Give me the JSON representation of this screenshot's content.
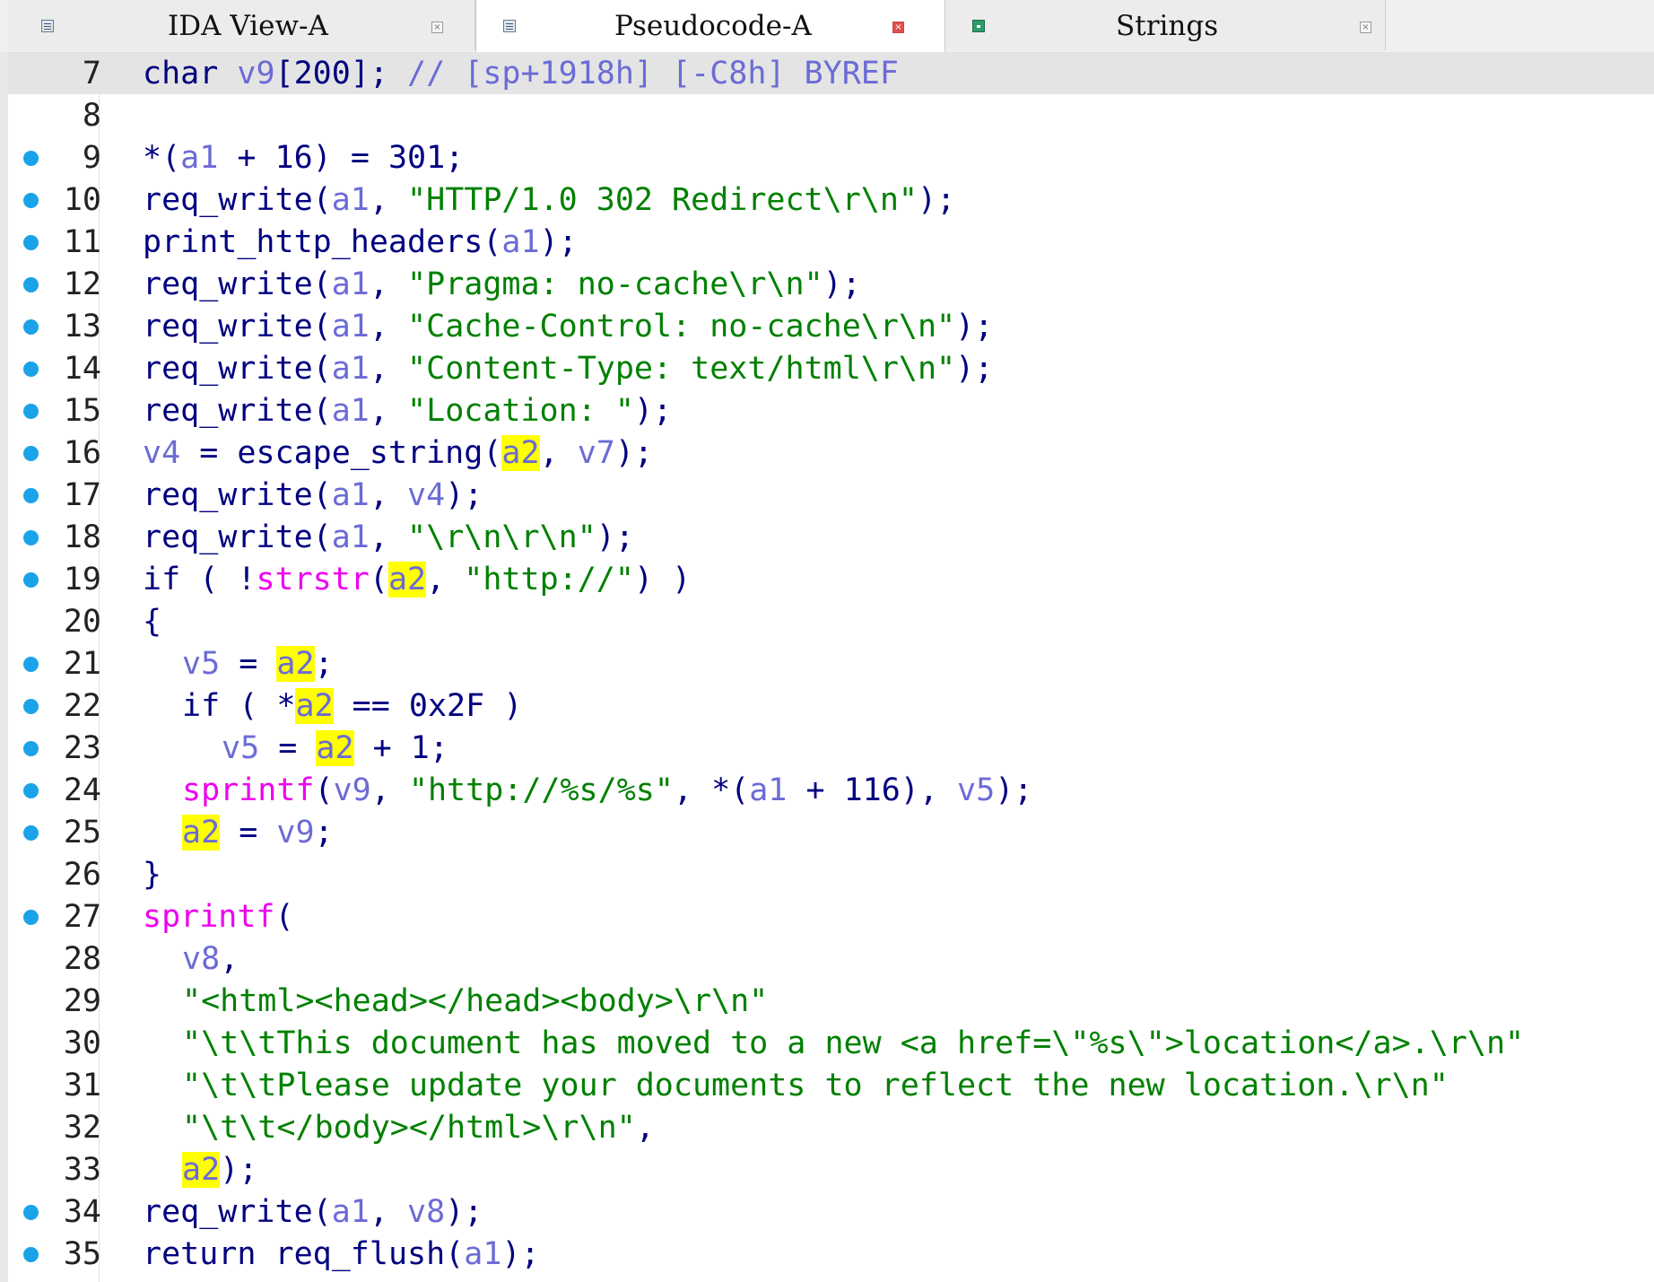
{
  "tabs": [
    {
      "label": "IDA View-A",
      "active": false,
      "close_style": "gray"
    },
    {
      "label": "Pseudocode-A",
      "active": true,
      "close_style": "red"
    },
    {
      "label": "Strings",
      "active": false,
      "close_style": "gray"
    }
  ],
  "tab_close_glyph": "×",
  "colors": {
    "keyword": "#000080",
    "variable": "#6b6bd6",
    "string": "#008000",
    "library_function": "#ee00ee",
    "highlight": "#ffff00",
    "breakpoint_dot": "#1aa3e8"
  },
  "code": {
    "highlighted_variable": "a2",
    "lines": [
      {
        "num": "7",
        "dot": false,
        "text": "char v9[200]; // [sp+1918h] [-C8h] BYREF"
      },
      {
        "num": "8",
        "dot": false,
        "text": ""
      },
      {
        "num": "9",
        "dot": true,
        "text": "*(a1 + 16) = 301;"
      },
      {
        "num": "10",
        "dot": true,
        "text": "req_write(a1, \"HTTP/1.0 302 Redirect\\r\\n\");"
      },
      {
        "num": "11",
        "dot": true,
        "text": "print_http_headers(a1);"
      },
      {
        "num": "12",
        "dot": true,
        "text": "req_write(a1, \"Pragma: no-cache\\r\\n\");"
      },
      {
        "num": "13",
        "dot": true,
        "text": "req_write(a1, \"Cache-Control: no-cache\\r\\n\");"
      },
      {
        "num": "14",
        "dot": true,
        "text": "req_write(a1, \"Content-Type: text/html\\r\\n\");"
      },
      {
        "num": "15",
        "dot": true,
        "text": "req_write(a1, \"Location: \");"
      },
      {
        "num": "16",
        "dot": true,
        "text": "v4 = escape_string(a2, v7);"
      },
      {
        "num": "17",
        "dot": true,
        "text": "req_write(a1, v4);"
      },
      {
        "num": "18",
        "dot": true,
        "text": "req_write(a1, \"\\r\\n\\r\\n\");"
      },
      {
        "num": "19",
        "dot": true,
        "text": "if ( !strstr(a2, \"http://\") )"
      },
      {
        "num": "20",
        "dot": false,
        "text": "{"
      },
      {
        "num": "21",
        "dot": true,
        "text": "v5 = a2;"
      },
      {
        "num": "22",
        "dot": true,
        "text": "if ( *a2 == 0x2F )"
      },
      {
        "num": "23",
        "dot": true,
        "text": "v5 = a2 + 1;"
      },
      {
        "num": "24",
        "dot": true,
        "text": "sprintf(v9, \"http://%s/%s\", *(a1 + 116), v5);"
      },
      {
        "num": "25",
        "dot": true,
        "text": "a2 = v9;"
      },
      {
        "num": "26",
        "dot": false,
        "text": "}"
      },
      {
        "num": "27",
        "dot": true,
        "text": "sprintf("
      },
      {
        "num": "28",
        "dot": false,
        "text": "v8,"
      },
      {
        "num": "29",
        "dot": false,
        "text": "\"<html><head></head><body>\\r\\n\""
      },
      {
        "num": "30",
        "dot": false,
        "text": "\"\\t\\tThis document has moved to a new <a href=\\\"%s\\\">location</a>.\\r\\n\""
      },
      {
        "num": "31",
        "dot": false,
        "text": "\"\\t\\tPlease update your documents to reflect the new location.\\r\\n\""
      },
      {
        "num": "32",
        "dot": false,
        "text": "\"\\t\\t</body></html>\\r\\n\","
      },
      {
        "num": "33",
        "dot": false,
        "text": "a2);"
      },
      {
        "num": "34",
        "dot": true,
        "text": "req_write(a1, v8);"
      },
      {
        "num": "35",
        "dot": true,
        "text": "return req_flush(a1);"
      }
    ]
  }
}
